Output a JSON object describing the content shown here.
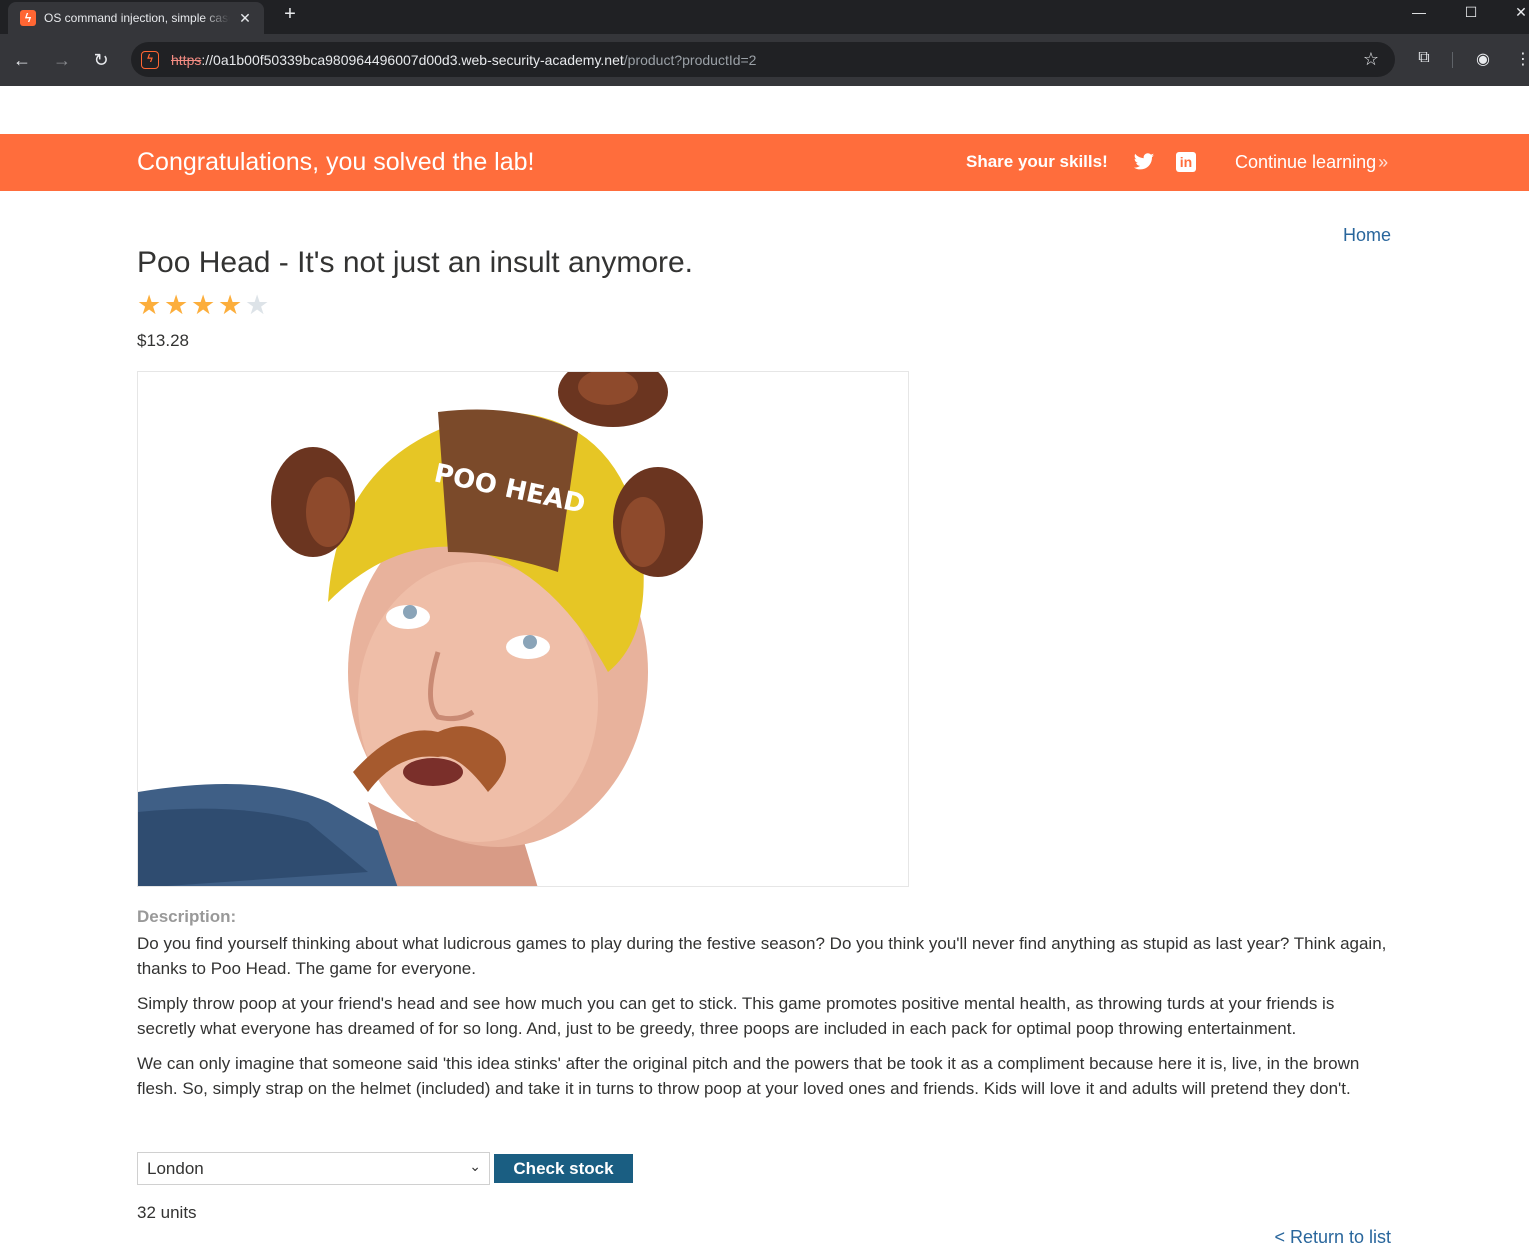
{
  "browser": {
    "tab_title": "OS command injection, simple case",
    "tab_favicon": "burp-lightning-icon",
    "new_tab": "+",
    "url_scheme": "https",
    "url_host": "://0a1b00f50339bca980964496007d00d3.web-security-academy.net",
    "url_path": "/product?productId=2",
    "controls": {
      "minimize": "—",
      "maximize": "☐",
      "close": "✕"
    }
  },
  "banner": {
    "title": "Congratulations, you solved the lab!",
    "share": "Share your skills!",
    "continue": "Continue learning",
    "continue_chevron": "»",
    "color": "#ff6d3c"
  },
  "nav": {
    "home": "Home"
  },
  "product": {
    "title": "Poo Head - It's not just an insult anymore.",
    "rating": 4,
    "rating_max": 5,
    "price": "$13.28",
    "image_cap_text": "POO HEAD"
  },
  "description": {
    "label": "Description:",
    "paragraphs": [
      "Do you find yourself thinking about what ludicrous games to play during the festive season? Do you think you'll never find anything as stupid as last year? Think again, thanks to Poo Head. The game for everyone.",
      "Simply throw poop at your friend's head and see how much you can get to stick. This game promotes positive mental health, as throwing turds at your friends is secretly what everyone has dreamed of for so long. And, just to be greedy, three poops are included in each pack for optimal poop throwing entertainment.",
      "We can only imagine that someone said 'this idea stinks' after the original pitch and the powers that be took it as a compliment because here it is, live, in the brown flesh. So, simply strap on the helmet (included) and take it in turns to throw poop at your loved ones and friends. Kids will love it and adults will pretend they don't."
    ]
  },
  "stock": {
    "selected_store": "London",
    "button": "Check stock",
    "result": "32 units",
    "button_color": "#1a5e82"
  },
  "footer": {
    "return": "< Return to list"
  }
}
